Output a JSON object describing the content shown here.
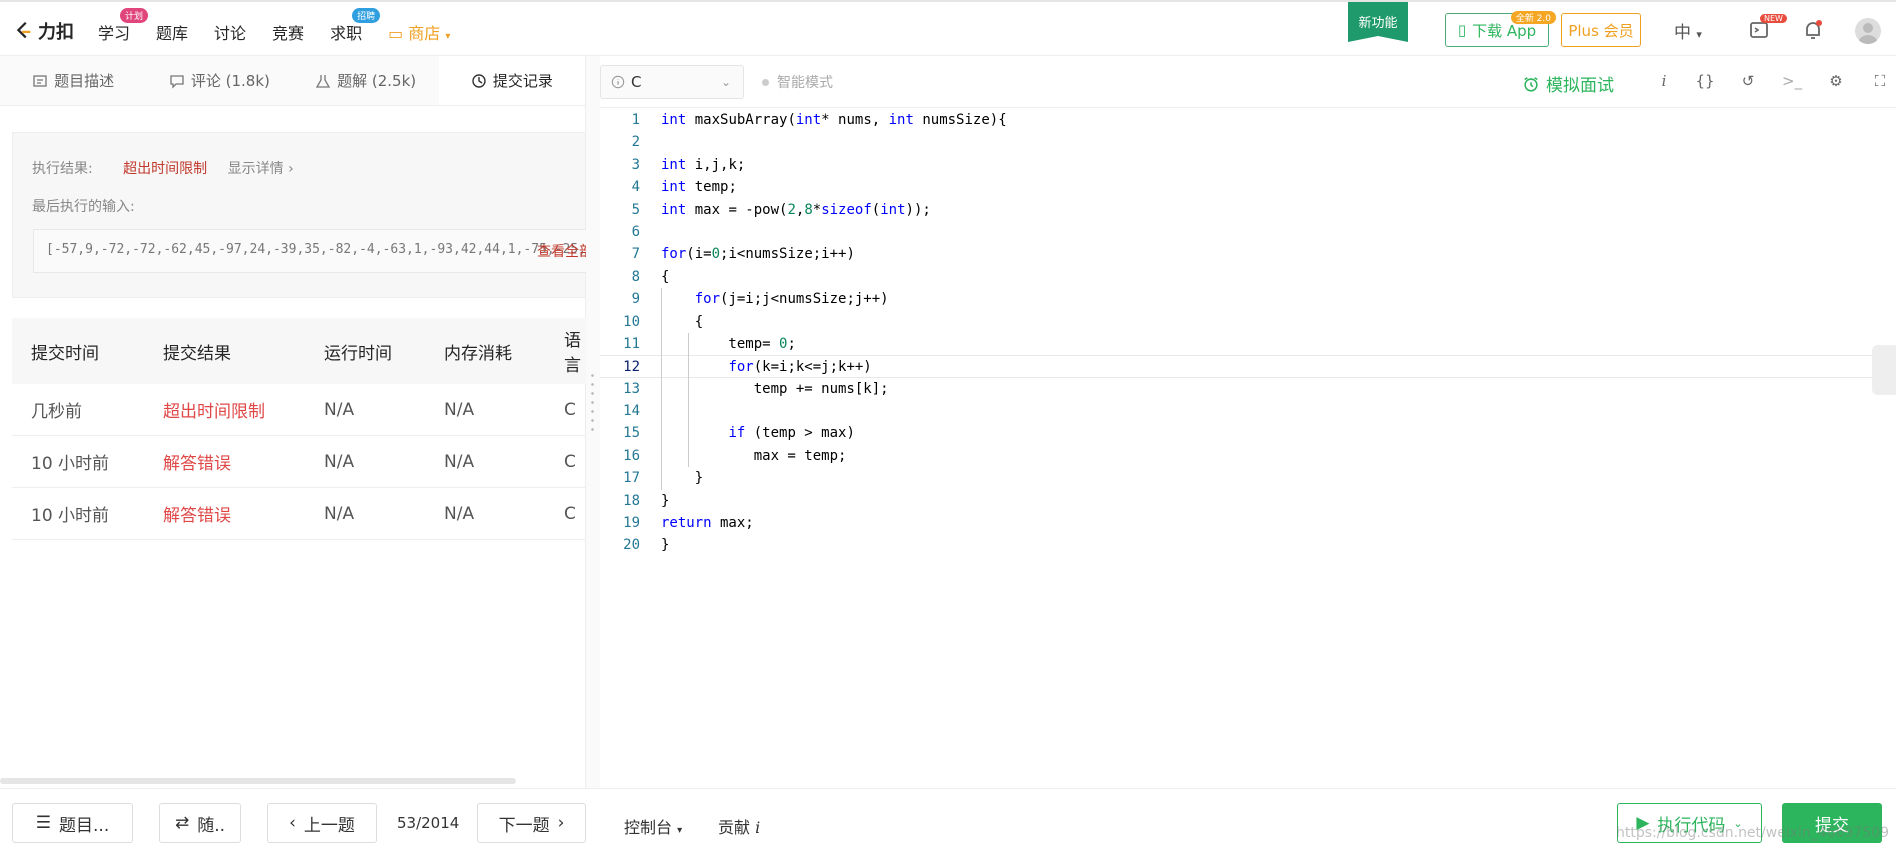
{
  "header": {
    "logo_text": "力扣",
    "nav": [
      {
        "label": "学习",
        "badge": "计划",
        "badge_color": "#e0457b"
      },
      {
        "label": "题库"
      },
      {
        "label": "讨论"
      },
      {
        "label": "竞赛"
      },
      {
        "label": "求职",
        "badge": "招聘",
        "badge_color": "#2f9fe0"
      },
      {
        "label": "商店"
      }
    ],
    "new_feature": "新功能",
    "download_app": "下载 App",
    "download_badge": "全新 2.0",
    "plus": "Plus 会员",
    "language": "中",
    "notify_badge": "NEW"
  },
  "left": {
    "tabs": [
      "题目描述",
      "评论 (1.8k)",
      "题解 (2.5k)",
      "提交记录"
    ],
    "result_label": "执行结果:",
    "result_status": "超出时间限制",
    "show_detail": "显示详情 ›",
    "last_input_label": "最后执行的输入:",
    "last_input": "[-57,9,-72,-72,-62,45,-97,24,-39,35,-82,-4,-63,1,-93,42,44,1,-75,-25,-87,-...",
    "view_all": "查看全部",
    "table": {
      "headers": [
        "提交时间",
        "提交结果",
        "运行时间",
        "内存消耗",
        "语言"
      ],
      "rows": [
        {
          "time": "几秒前",
          "result": "超出时间限制",
          "runtime": "N/A",
          "memory": "N/A",
          "lang": "C"
        },
        {
          "time": "10 小时前",
          "result": "解答错误",
          "runtime": "N/A",
          "memory": "N/A",
          "lang": "C"
        },
        {
          "time": "10 小时前",
          "result": "解答错误",
          "runtime": "N/A",
          "memory": "N/A",
          "lang": "C"
        }
      ]
    }
  },
  "editor": {
    "language": "C",
    "smart_mode": "智能模式",
    "mock_interview": "模拟面试",
    "lines": [
      "int maxSubArray(int* nums, int numsSize){",
      "",
      "int i,j,k;",
      "int temp;",
      "int max = -pow(2,8*sizeof(int));",
      "",
      "for(i=0;i<numsSize;i++)",
      "{",
      "    for(j=i;j<numsSize;j++)",
      "    {",
      "        temp= 0;",
      "        for(k=i;k<=j;k++)",
      "           temp += nums[k];",
      "",
      "        if (temp > max)",
      "           max = temp;",
      "    }",
      "}",
      "return max;",
      "}"
    ],
    "current_line": 12
  },
  "bottom": {
    "problem_list": "题目...",
    "random": "随..",
    "prev": "上一题",
    "page": "53/2014",
    "next": "下一题",
    "console": "控制台",
    "contribute": "贡献",
    "run": "执行代码",
    "submit": "提交",
    "watermark": "https://blog.csdn.net/weixin_46697509"
  }
}
